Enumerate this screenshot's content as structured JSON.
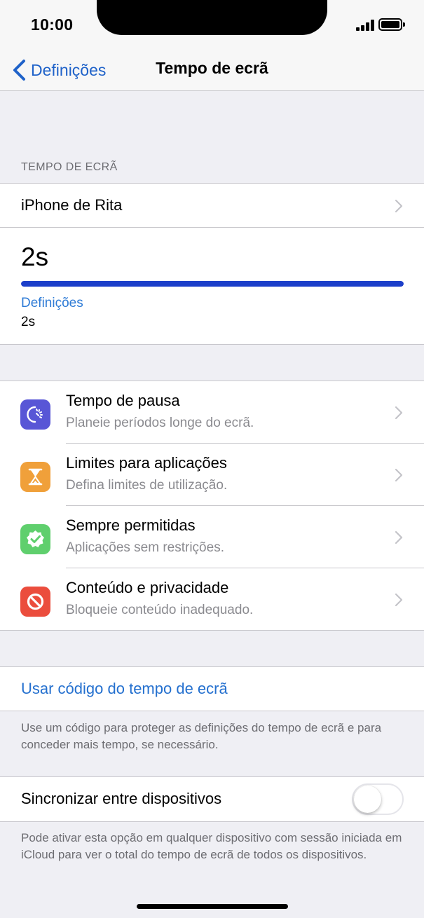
{
  "status_bar": {
    "time": "10:00"
  },
  "nav": {
    "back_label": "Definições",
    "title": "Tempo de ecrã"
  },
  "screen_time": {
    "section_header": "TEMPO DE ECRÃ",
    "device_name": "iPhone de Rita",
    "total": "2s",
    "progress_fraction": 1.0,
    "legend_label": "Definições",
    "legend_value": "2s"
  },
  "items": [
    {
      "title": "Tempo de pausa",
      "subtitle": "Planeie períodos longe do ecrã.",
      "icon": "downtime-icon",
      "color": "#5856d6"
    },
    {
      "title": "Limites para aplicações",
      "subtitle": "Defina limites de utilização.",
      "icon": "hourglass-icon",
      "color": "#f0a03a"
    },
    {
      "title": "Sempre permitidas",
      "subtitle": "Aplicações sem restrições.",
      "icon": "checkmark-badge-icon",
      "color": "#5fcf6d"
    },
    {
      "title": "Conteúdo e privacidade",
      "subtitle": "Bloqueie conteúdo inadequado.",
      "icon": "restriction-icon",
      "color": "#eb4d3d"
    }
  ],
  "passcode": {
    "link_label": "Usar código do tempo de ecrã",
    "footer": "Use um código para proteger as definições do tempo de ecrã e para conceder mais tempo, se necessário."
  },
  "sync": {
    "label": "Sincronizar entre dispositivos",
    "enabled": false,
    "footer": "Pode ativar esta opção em qualquer dispositivo com sessão iniciada em iCloud para ver o total do tempo de ecrã de todos os dispositivos."
  },
  "colors": {
    "accent": "#1f62c9",
    "progress": "#1c3fca",
    "legend": "#2e7bd6"
  }
}
